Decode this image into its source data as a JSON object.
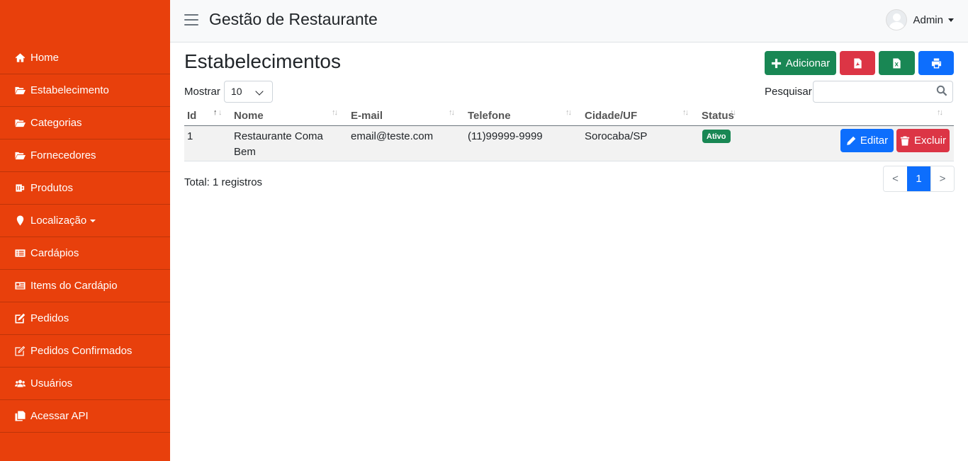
{
  "app": {
    "title": "Gestão de Restaurante"
  },
  "user": {
    "name": "Admin"
  },
  "sidebar": {
    "items": [
      {
        "label": "Home",
        "icon": "home-icon"
      },
      {
        "label": "Estabelecimento",
        "icon": "folder-open-icon"
      },
      {
        "label": "Categorias",
        "icon": "folder-open-icon"
      },
      {
        "label": "Fornecedores",
        "icon": "folder-open-icon"
      },
      {
        "label": "Produtos",
        "icon": "beer-mug-icon"
      },
      {
        "label": "Localização",
        "icon": "map-marker-icon"
      },
      {
        "label": "Cardápios",
        "icon": "list-alt-icon"
      },
      {
        "label": "Items do Cardápio",
        "icon": "newspaper-icon"
      },
      {
        "label": "Pedidos",
        "icon": "edit-icon"
      },
      {
        "label": "Pedidos Confirmados",
        "icon": "edit-outline-icon"
      },
      {
        "label": "Usuários",
        "icon": "users-icon"
      },
      {
        "label": "Acessar API",
        "icon": "copy-icon"
      }
    ]
  },
  "page": {
    "title": "Estabelecimentos",
    "add_label": "Adicionar"
  },
  "controls": {
    "show_label": "Mostrar",
    "show_value": "10",
    "search_label": "Pesquisar",
    "search_value": ""
  },
  "table": {
    "columns": [
      "Id",
      "Nome",
      "E-mail",
      "Telefone",
      "Cidade/UF",
      "Status"
    ],
    "rows": [
      {
        "id": "1",
        "nome_line1": "Restaurante Coma",
        "nome_line2": "Bem",
        "email": "email@teste.com",
        "telefone": "(11)99999-9999",
        "cidade": "Sorocaba/SP",
        "status": "Ativo",
        "edit_label": "Editar",
        "delete_label": "Excluir"
      }
    ]
  },
  "footer": {
    "total": "Total: 1 registros",
    "prev": "<",
    "page": "1",
    "next": ">"
  },
  "colors": {
    "sidebar": "#e8400c",
    "success": "#198754",
    "danger": "#dc3545",
    "primary": "#0d6efd"
  }
}
